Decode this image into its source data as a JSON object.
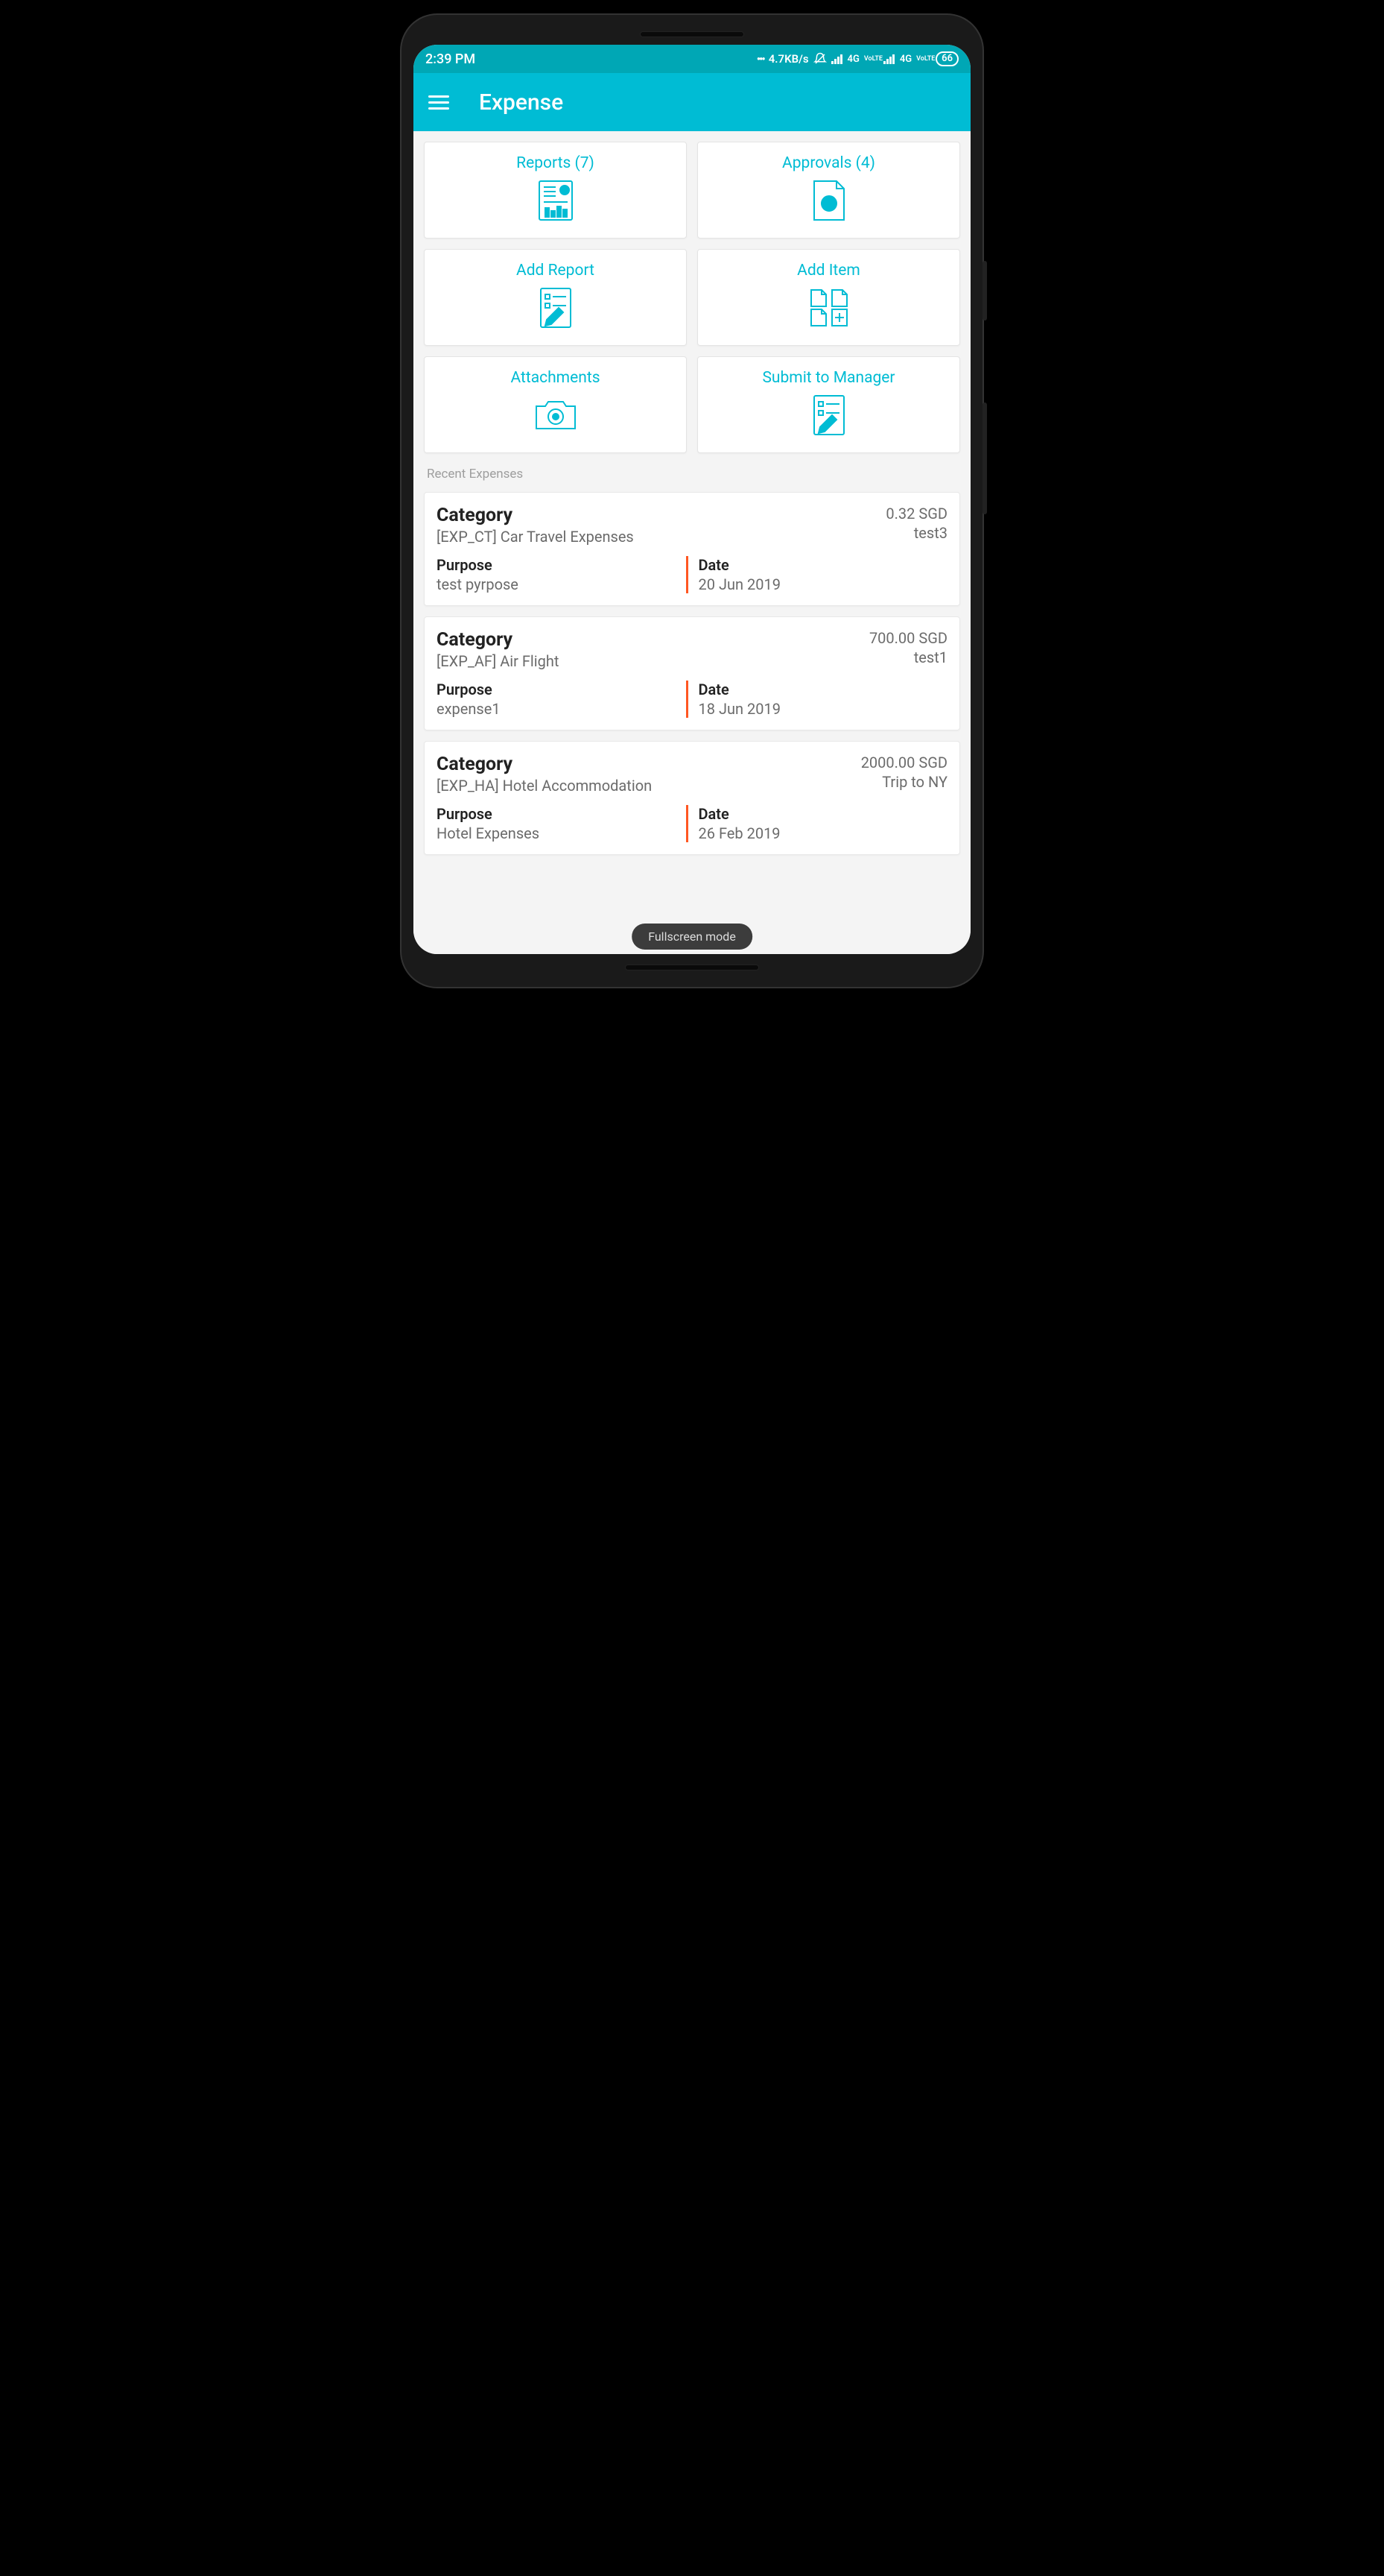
{
  "statusBar": {
    "time": "2:39 PM",
    "netSpeed": "4.7KB/s",
    "sig1": "4G",
    "volte1": "VoLTE",
    "sig2": "4G",
    "volte2": "VoLTE",
    "battery": "66"
  },
  "appBar": {
    "title": "Expense"
  },
  "tiles": {
    "reports": "Reports (7)",
    "approvals": "Approvals (4)",
    "addReport": "Add Report",
    "addItem": "Add Item",
    "attachments": "Attachments",
    "submit": "Submit to Manager"
  },
  "sectionLabel": "Recent Expenses",
  "labels": {
    "category": "Category",
    "purpose": "Purpose",
    "date": "Date"
  },
  "expenses": [
    {
      "category": "[EXP_CT] Car Travel Expenses",
      "amount": "0.32 SGD",
      "tag": "test3",
      "purpose": "test pyrpose",
      "date": "20 Jun 2019"
    },
    {
      "category": "[EXP_AF] Air Flight",
      "amount": "700.00 SGD",
      "tag": "test1",
      "purpose": "expense1",
      "date": "18 Jun 2019"
    },
    {
      "category": "[EXP_HA] Hotel Accommodation",
      "amount": "2000.00 SGD",
      "tag": "Trip to NY",
      "purpose": "Hotel Expenses",
      "date": "26 Feb 2019"
    }
  ],
  "fullscreen": "Fullscreen mode"
}
